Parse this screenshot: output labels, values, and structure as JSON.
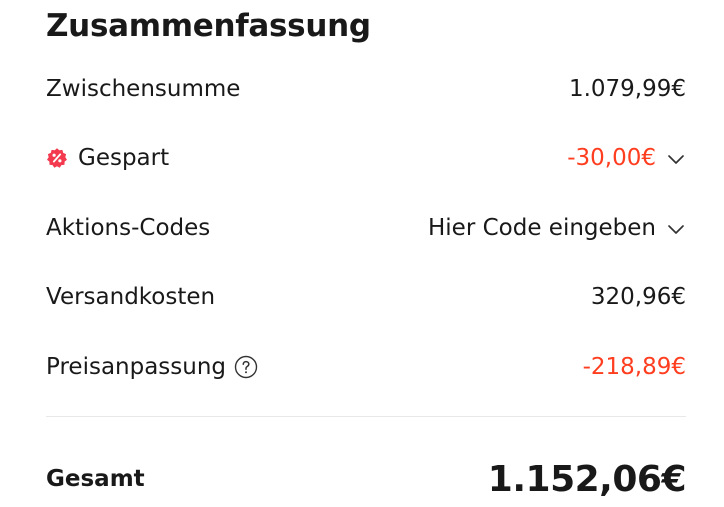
{
  "summary": {
    "title": "Zusammenfassung",
    "rows": {
      "subtotal": {
        "label": "Zwischensumme",
        "value": "1.079,99€"
      },
      "saved": {
        "label": "Gespart",
        "value": "-30,00€",
        "icon": "discount-badge-icon",
        "chevron": "chevron-down-icon"
      },
      "promo": {
        "label": "Aktions-Codes",
        "value": "Hier Code eingeben",
        "chevron": "chevron-down-icon"
      },
      "shipping": {
        "label": "Versandkosten",
        "value": "320,96€"
      },
      "adjustment": {
        "label": "Preisanpassung",
        "value": "-218,89€",
        "icon": "help-circle-icon"
      }
    },
    "total": {
      "label": "Gesamt",
      "value": "1.152,06€"
    }
  },
  "colors": {
    "accent_red": "#ff3d1f",
    "text": "#191919",
    "divider": "#e8e8e8",
    "badge_red": "#f33a4f"
  }
}
